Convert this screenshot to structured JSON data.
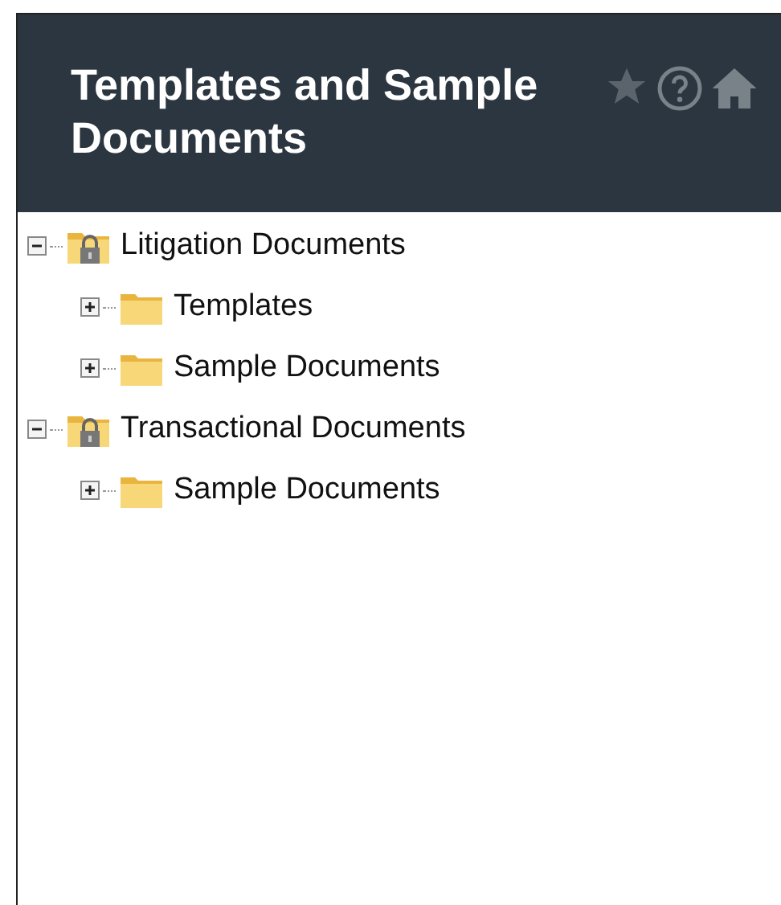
{
  "header": {
    "title": "Templates and Sample Documents"
  },
  "tree": [
    {
      "label": "Litigation Documents",
      "kind": "locked",
      "expanded": true,
      "children": [
        {
          "label": "Templates",
          "kind": "folder",
          "expanded": false
        },
        {
          "label": "Sample Documents",
          "kind": "folder",
          "expanded": false
        }
      ]
    },
    {
      "label": "Transactional Documents",
      "kind": "locked",
      "expanded": true,
      "children": [
        {
          "label": "Sample Documents",
          "kind": "folder",
          "expanded": false
        }
      ]
    }
  ]
}
